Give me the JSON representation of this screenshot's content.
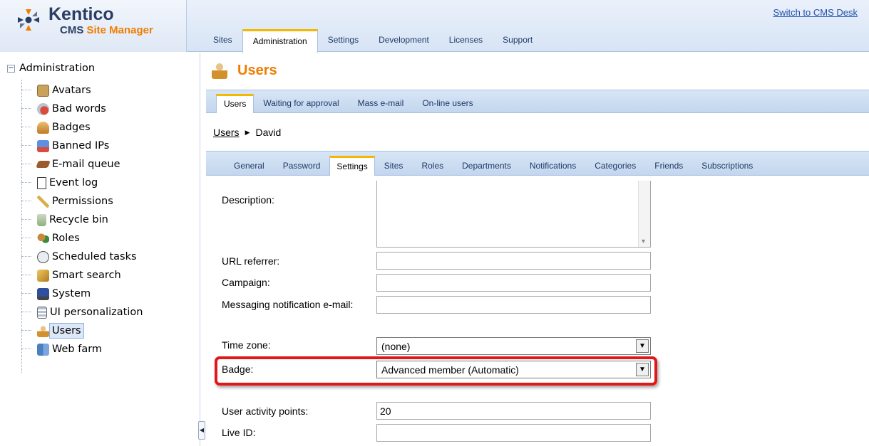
{
  "header": {
    "brand": "Kentico",
    "product_prefix": "CMS ",
    "product_accent": "Site Manager",
    "switch_link": "Switch to CMS Desk",
    "tabs": [
      {
        "label": "Sites",
        "active": false
      },
      {
        "label": "Administration",
        "active": true
      },
      {
        "label": "Settings",
        "active": false
      },
      {
        "label": "Development",
        "active": false
      },
      {
        "label": "Licenses",
        "active": false
      },
      {
        "label": "Support",
        "active": false
      }
    ]
  },
  "tree": {
    "root": {
      "toggle": "−",
      "label": "Administration"
    },
    "items": [
      {
        "label": "Avatars",
        "icon": "avatar-icon",
        "color": "#c9a25b"
      },
      {
        "label": "Bad words",
        "icon": "bad-words-icon",
        "color": "#d94b3c"
      },
      {
        "label": "Badges",
        "icon": "badge-icon",
        "color": "#e0a040"
      },
      {
        "label": "Banned IPs",
        "icon": "banned-ip-icon",
        "color": "#3d6bc4"
      },
      {
        "label": "E-mail queue",
        "icon": "email-queue-icon",
        "color": "#9b5b2e"
      },
      {
        "label": "Event log",
        "icon": "event-log-icon",
        "color": "#ffffff"
      },
      {
        "label": "Permissions",
        "icon": "key-icon",
        "color": "#d6b04a"
      },
      {
        "label": "Recycle bin",
        "icon": "recycle-bin-icon",
        "color": "#8db07a"
      },
      {
        "label": "Roles",
        "icon": "roles-icon",
        "color": "#c78a3b"
      },
      {
        "label": "Scheduled tasks",
        "icon": "clock-icon",
        "color": "#e9edf2"
      },
      {
        "label": "Smart search",
        "icon": "smart-search-icon",
        "color": "#d9a84a"
      },
      {
        "label": "System",
        "icon": "computer-icon",
        "color": "#2e4f9e"
      },
      {
        "label": "UI personalization",
        "icon": "ui-personalization-icon",
        "color": "#b7c2cf"
      },
      {
        "label": "Users",
        "icon": "user-icon",
        "color": "#d3912e",
        "selected": true
      },
      {
        "label": "Web farm",
        "icon": "web-farm-icon",
        "color": "#4a7fc0"
      }
    ]
  },
  "page": {
    "title": "Users",
    "sub_tabs": [
      {
        "label": "Users",
        "active": true
      },
      {
        "label": "Waiting for approval",
        "active": false
      },
      {
        "label": "Mass e-mail",
        "active": false
      },
      {
        "label": "On-line users",
        "active": false
      }
    ],
    "breadcrumb": {
      "link": "Users",
      "separator": "▶",
      "current": "David"
    },
    "user_tabs": [
      {
        "label": "General",
        "active": false
      },
      {
        "label": "Password",
        "active": false
      },
      {
        "label": "Settings",
        "active": true
      },
      {
        "label": "Sites",
        "active": false
      },
      {
        "label": "Roles",
        "active": false
      },
      {
        "label": "Departments",
        "active": false
      },
      {
        "label": "Notifications",
        "active": false
      },
      {
        "label": "Categories",
        "active": false
      },
      {
        "label": "Friends",
        "active": false
      },
      {
        "label": "Subscriptions",
        "active": false
      }
    ]
  },
  "form": {
    "description_label": "Description:",
    "description_value": "",
    "url_referrer_label": "URL referrer:",
    "url_referrer_value": "",
    "campaign_label": "Campaign:",
    "campaign_value": "",
    "messaging_label": "Messaging notification e-mail:",
    "messaging_value": "",
    "time_zone_label": "Time zone:",
    "time_zone_value": "(none)",
    "badge_label": "Badge:",
    "badge_value": "Advanced member (Automatic)",
    "activity_points_label": "User activity points:",
    "activity_points_value": "20",
    "live_id_label": "Live ID:",
    "live_id_value": ""
  },
  "colors": {
    "accent": "#f07c00",
    "highlight": "#e01818",
    "tab_indicator": "#f5b800"
  }
}
